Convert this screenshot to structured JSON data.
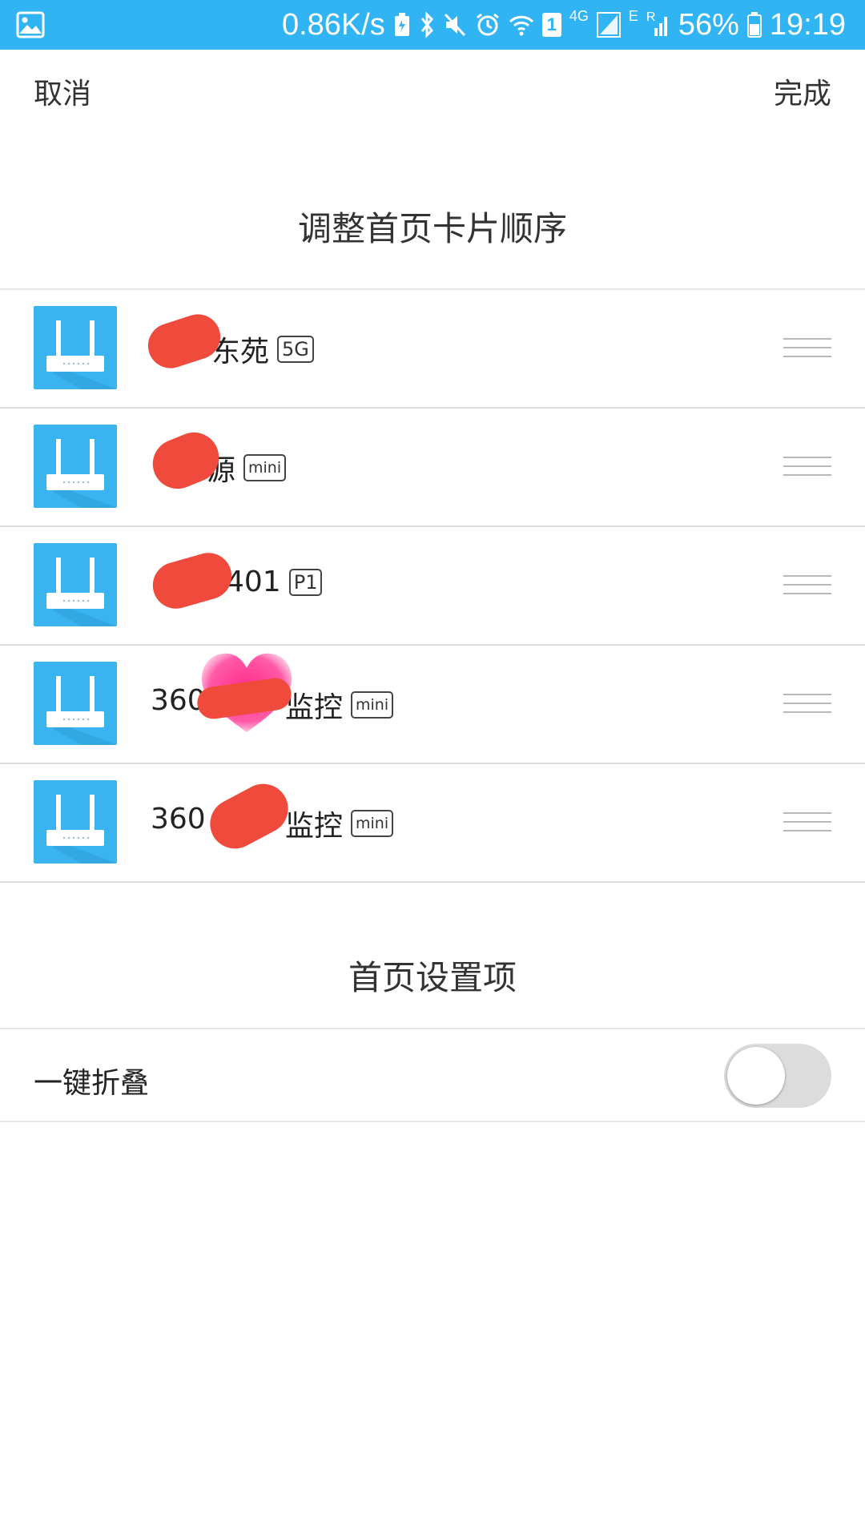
{
  "status_bar": {
    "network_speed": "0.86K/s",
    "battery": "56%",
    "time": "19:19",
    "network_4g": "4G",
    "network_e": "E",
    "network_r": "R",
    "sim": "1",
    "icons": [
      "image-icon",
      "battery-saver-icon",
      "bluetooth-icon",
      "mute-icon",
      "alarm-icon",
      "wifi-icon",
      "sim-1-icon",
      "signal-4g-icon",
      "signal-e-icon",
      "battery-icon"
    ]
  },
  "nav": {
    "cancel_label": "取消",
    "done_label": "完成"
  },
  "cards_section": {
    "title": "调整首页卡片顺序",
    "items": [
      {
        "name": "东苑",
        "badge": "5G",
        "icon": "router-icon",
        "handle": "drag-handle-icon"
      },
      {
        "name": "源",
        "badge": "mini",
        "icon": "router-icon",
        "handle": "drag-handle-icon"
      },
      {
        "name": "401",
        "badge": "P1",
        "icon": "router-icon",
        "handle": "drag-handle-icon"
      },
      {
        "name_prefix": "360",
        "name": "监控",
        "badge": "mini",
        "icon": "router-icon",
        "handle": "drag-handle-icon"
      },
      {
        "name_prefix": "360",
        "name": "监控",
        "badge": "mini",
        "icon": "router-icon",
        "handle": "drag-handle-icon"
      }
    ]
  },
  "settings_section": {
    "title": "首页设置项",
    "items": [
      {
        "label": "一键折叠",
        "toggle_on": false
      }
    ]
  },
  "colors": {
    "status_bar": "#30b4f3",
    "router_icon_bg": "#3ab4f0",
    "redaction": "#ef4a3c",
    "heart_sticker": "#ff2d8a"
  }
}
